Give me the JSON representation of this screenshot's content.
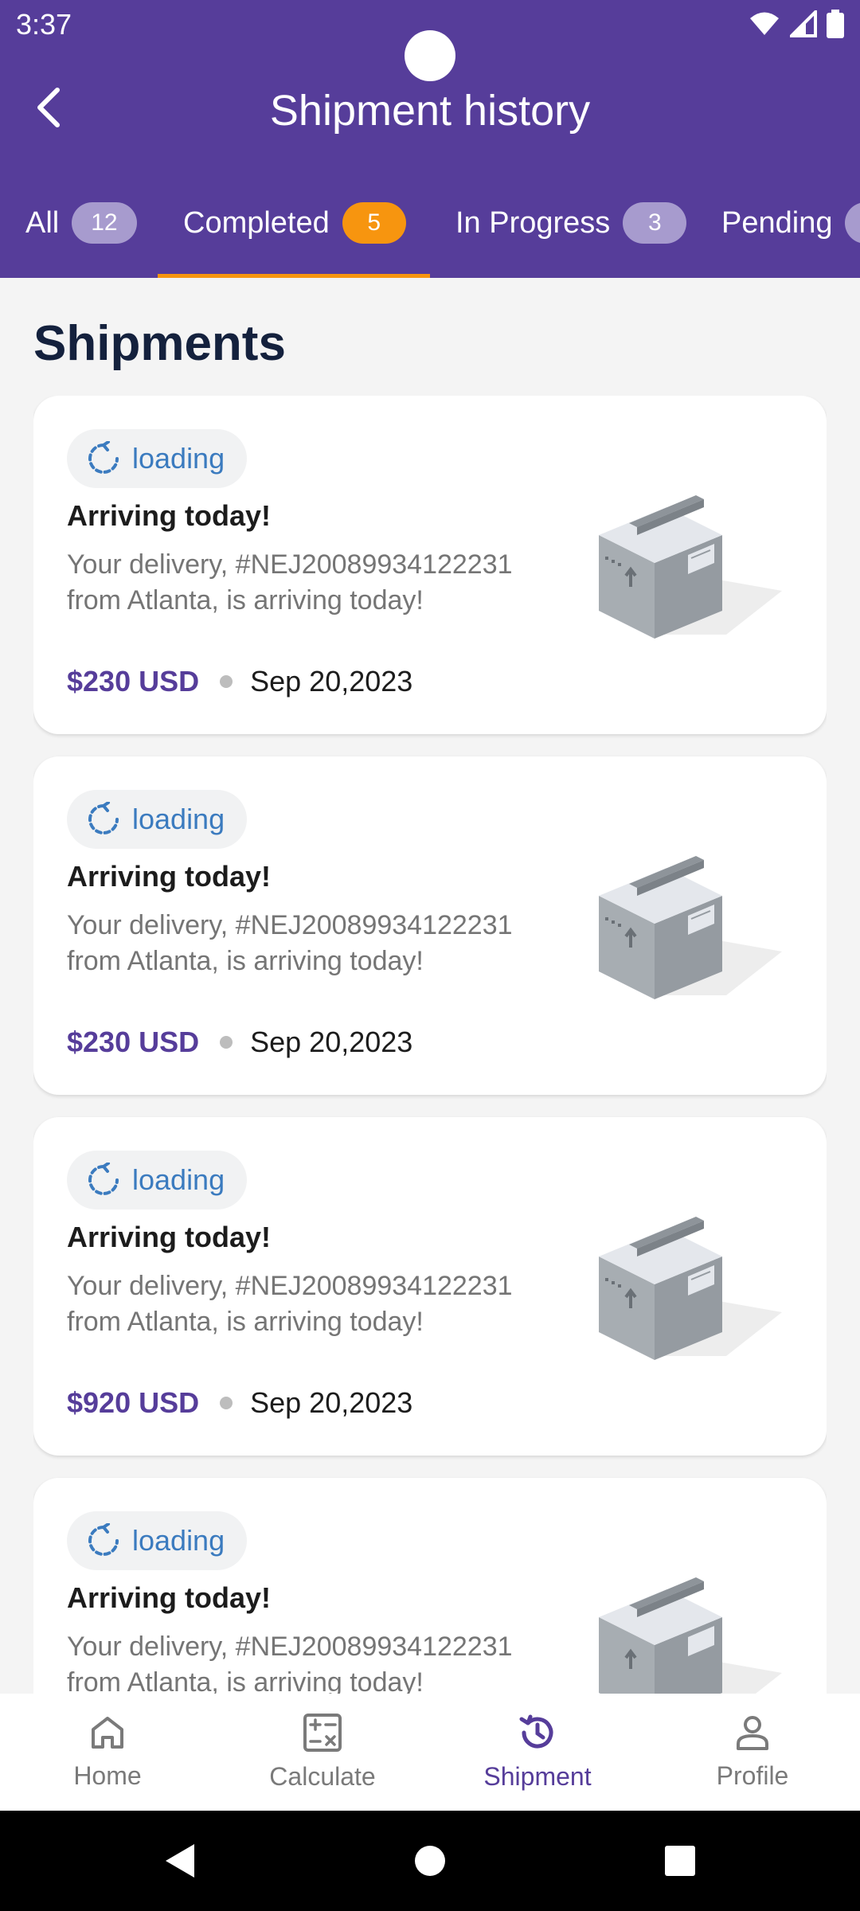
{
  "status_bar": {
    "time": "3:37"
  },
  "header": {
    "title": "Shipment history"
  },
  "tabs": [
    {
      "label": "All",
      "count": "12"
    },
    {
      "label": "Completed",
      "count": "5"
    },
    {
      "label": "In Progress",
      "count": "3"
    },
    {
      "label": "Pending",
      "count": ""
    }
  ],
  "section_title": "Shipments",
  "shipments": [
    {
      "status": "loading",
      "title": "Arriving today!",
      "line1": "Your delivery, #NEJ20089934122231",
      "line2": "from Atlanta, is arriving today!",
      "price": "$230 USD",
      "date": "Sep 20,2023"
    },
    {
      "status": "loading",
      "title": "Arriving today!",
      "line1": "Your delivery, #NEJ20089934122231",
      "line2": "from Atlanta, is arriving today!",
      "price": "$230 USD",
      "date": "Sep 20,2023"
    },
    {
      "status": "loading",
      "title": "Arriving today!",
      "line1": "Your delivery, #NEJ20089934122231",
      "line2": "from Atlanta, is arriving today!",
      "price": "$920 USD",
      "date": "Sep 20,2023"
    },
    {
      "status": "loading",
      "title": "Arriving today!",
      "line1": "Your delivery, #NEJ20089934122231",
      "line2": "from Atlanta, is arriving today!",
      "price": "",
      "date": ""
    }
  ],
  "bottom_nav": [
    {
      "label": "Home",
      "icon": "home-icon"
    },
    {
      "label": "Calculate",
      "icon": "calculator-icon"
    },
    {
      "label": "Shipment",
      "icon": "history-icon"
    },
    {
      "label": "Profile",
      "icon": "profile-icon"
    }
  ],
  "colors": {
    "brand": "#563d9a",
    "accent": "#f7950f",
    "status_blue": "#3b7bbf"
  }
}
